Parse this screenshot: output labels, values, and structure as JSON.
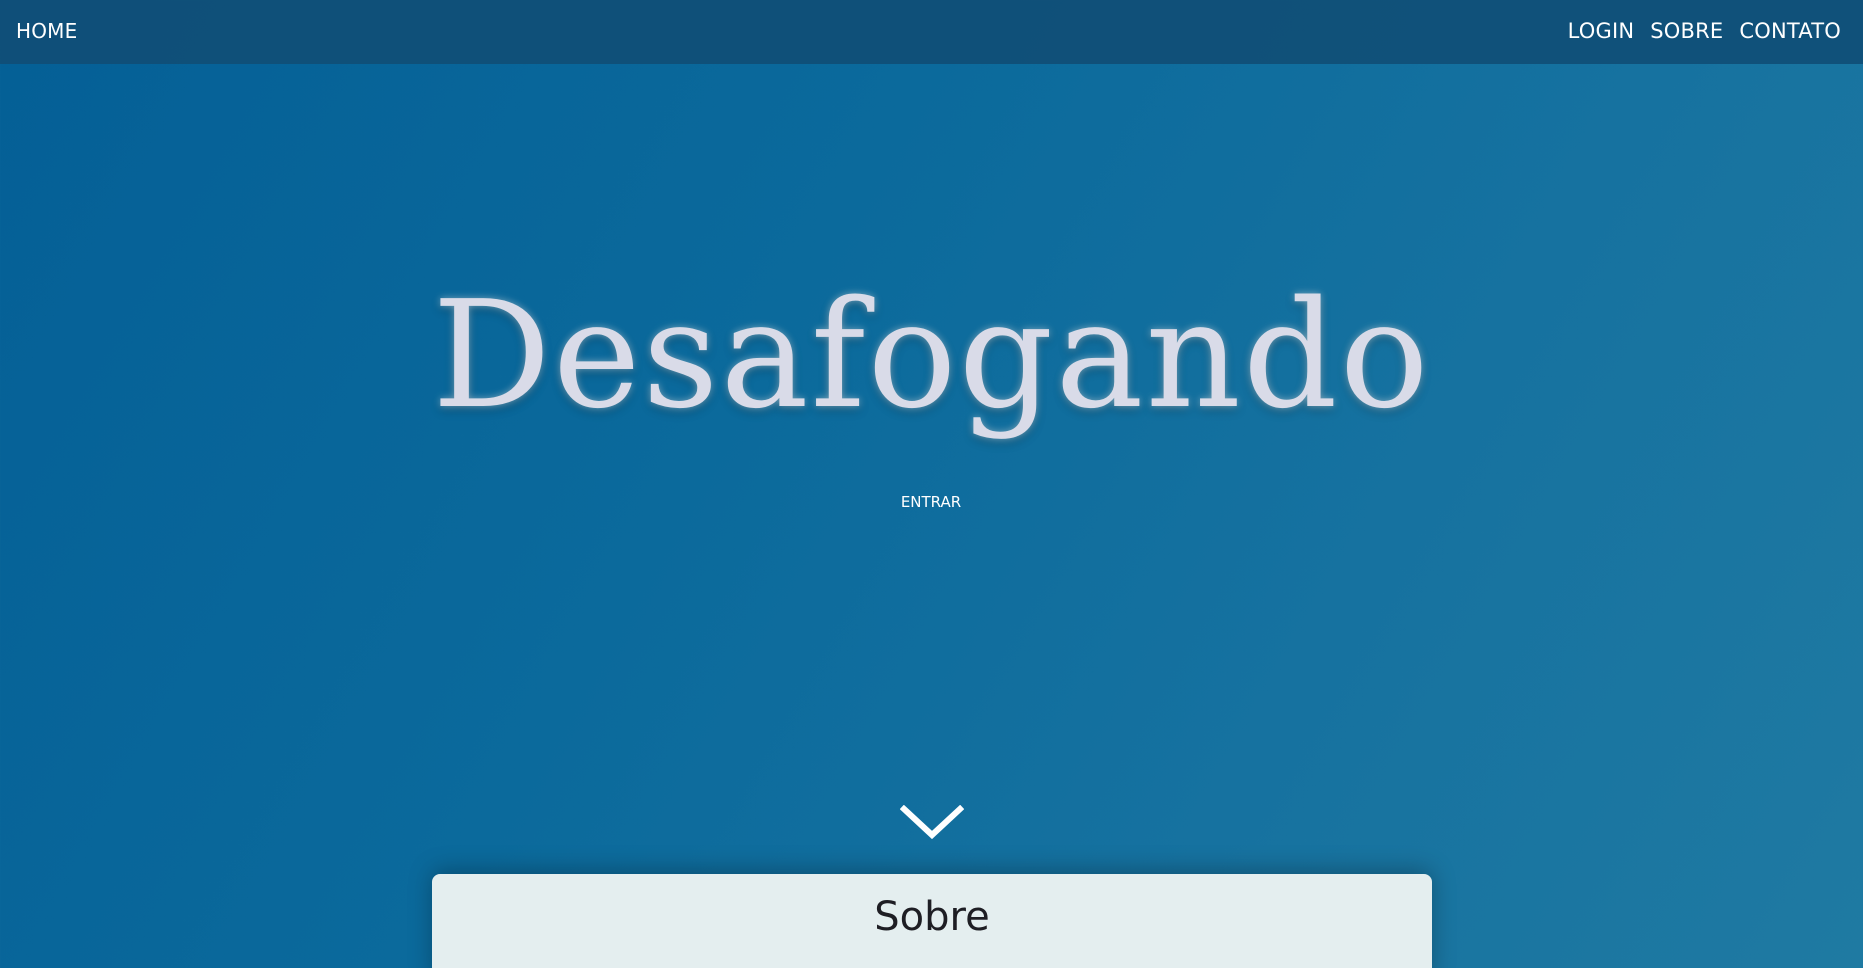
{
  "nav": {
    "home_label": "HOME",
    "links": [
      "LOGIN",
      "SOBRE",
      "CONTATO"
    ]
  },
  "hero": {
    "title": "Desafogando",
    "enter_label": "ENTRAR",
    "scroll_icon": "chevron-down-icon"
  },
  "about": {
    "title": "Sobre"
  },
  "colors": {
    "background_start": "#045f96",
    "background_end": "#1f7aa2",
    "navbar": "#104e76",
    "card": "#e4eeef",
    "title_text": "#d9dbe8"
  }
}
